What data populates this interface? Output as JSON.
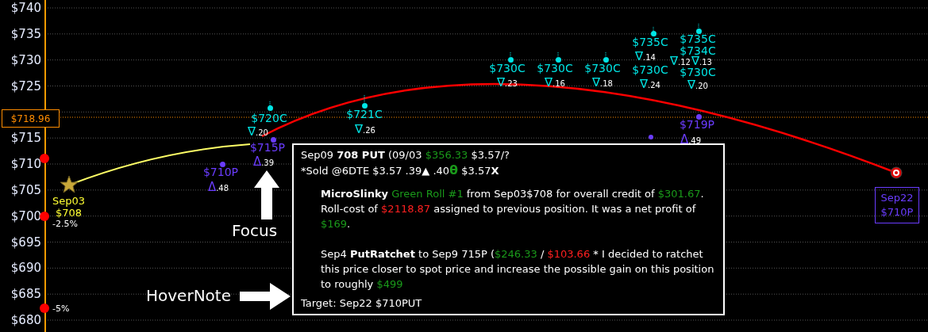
{
  "y_axis": {
    "ticks": [
      "$740",
      "$735",
      "$730",
      "$725",
      "$715",
      "$710",
      "$705",
      "$700",
      "$695",
      "$690",
      "$685",
      "$680"
    ]
  },
  "spot_price": "$718.96",
  "levels": [
    {
      "label": "-2.5%"
    },
    {
      "label": "-5%"
    }
  ],
  "start": {
    "date": "Sep03",
    "strike": "$708"
  },
  "target": {
    "date": "Sep22",
    "strike": "$710P"
  },
  "options": [
    {
      "kind": "call",
      "strike": "$720C",
      "symbol": "∇",
      "delta": ".20"
    },
    {
      "kind": "call",
      "strike": "$721C",
      "symbol": "∇",
      "delta": ".26"
    },
    {
      "kind": "call",
      "strike": "$730C",
      "symbol": "∇",
      "delta": ".23"
    },
    {
      "kind": "call",
      "strike": "$730C",
      "symbol": "∇",
      "delta": ".16"
    },
    {
      "kind": "call",
      "strike": "$730C",
      "symbol": "∇",
      "delta": ".18"
    },
    {
      "kind": "call",
      "strike": "$735C",
      "symbol": "∇",
      "delta": ".14"
    },
    {
      "kind": "call",
      "strike": "$730C",
      "symbol": "∇",
      "delta": ".24"
    },
    {
      "kind": "call",
      "strike": "$735C",
      "symbol": "∇",
      "delta": ".12"
    },
    {
      "kind": "call",
      "strike": "$734C",
      "symbol": "∇",
      "delta": ".13"
    },
    {
      "kind": "call",
      "strike": "$730C",
      "symbol": "∇",
      "delta": ".20"
    },
    {
      "kind": "put",
      "strike": "$715P",
      "symbol": "Δ",
      "delta": ".39"
    },
    {
      "kind": "put",
      "strike": "$710P",
      "symbol": "Δ",
      "delta": ".48"
    },
    {
      "kind": "put",
      "strike": "$719P",
      "symbol": "Δ",
      "delta": ".49"
    }
  ],
  "callouts": [
    {
      "kind": "up",
      "label": "Focus"
    },
    {
      "kind": "right",
      "label": "HoverNote"
    }
  ],
  "hover_note": {
    "lines": [
      {
        "kind": "header",
        "segments": [
          {
            "kind": "plain",
            "text": "Sep09 "
          },
          {
            "kind": "bold",
            "text": "708 PUT"
          },
          {
            "kind": "plain",
            "text": " (09/03 "
          },
          {
            "kind": "green",
            "text": "$356.33"
          },
          {
            "kind": "plain",
            "text": " $3.57/?"
          }
        ]
      },
      {
        "kind": "header",
        "segments": [
          {
            "kind": "plain",
            "text": "*Sold @6DTE $3.57 .39"
          },
          {
            "kind": "bold",
            "text": "▲"
          },
          {
            "kind": "plain",
            "text": " .40"
          },
          {
            "kind": "greenbold",
            "text": "θ"
          },
          {
            "kind": "plain",
            "text": " $3.57"
          },
          {
            "kind": "bold",
            "text": "X"
          }
        ]
      },
      {
        "kind": "note",
        "segments": [
          {
            "kind": "bold",
            "text": "MicroSlinky"
          },
          {
            "kind": "green",
            "text": " Green Roll #1"
          },
          {
            "kind": "plain",
            "text": " from Sep03$708 for overall credit of "
          },
          {
            "kind": "green",
            "text": "$301.67"
          },
          {
            "kind": "plain",
            "text": ". Roll-cost of "
          },
          {
            "kind": "red",
            "text": "$2118.87"
          },
          {
            "kind": "plain",
            "text": " assigned to previous position. It was a net profit of "
          },
          {
            "kind": "green",
            "text": "$169"
          },
          {
            "kind": "plain",
            "text": "."
          }
        ]
      },
      {
        "kind": "note",
        "segments": [
          {
            "kind": "plain",
            "text": "Sep4 "
          },
          {
            "kind": "bold",
            "text": "PutRatchet"
          },
          {
            "kind": "plain",
            "text": " to Sep9 715P ("
          },
          {
            "kind": "green",
            "text": "$246.33"
          },
          {
            "kind": "plain",
            "text": " / "
          },
          {
            "kind": "red",
            "text": "$103.66"
          },
          {
            "kind": "plain",
            "text": " * I decided to ratchet this price closer to spot price and increase the possible gain on this position to roughly "
          },
          {
            "kind": "green",
            "text": "$499"
          }
        ]
      },
      {
        "kind": "footer",
        "segments": [
          {
            "kind": "plain",
            "text": "Target: Sep22 $710PUT"
          }
        ]
      }
    ]
  }
}
